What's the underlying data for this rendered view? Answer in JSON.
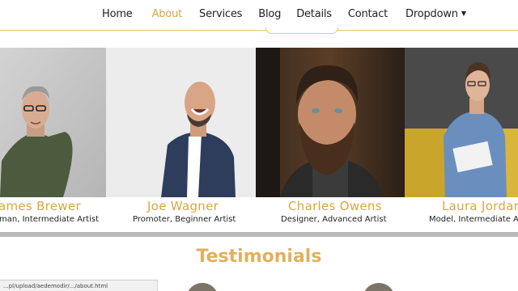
{
  "nav": {
    "items": [
      {
        "label": "Home",
        "active": false
      },
      {
        "label": "About",
        "active": true
      },
      {
        "label": "Services",
        "active": false
      },
      {
        "label": "Blog",
        "active": false
      },
      {
        "label": "Details",
        "active": false
      },
      {
        "label": "Contact",
        "active": false
      },
      {
        "label": "Dropdown",
        "active": false,
        "has_caret": true
      }
    ]
  },
  "team": [
    {
      "name": "ames Brewer",
      "role": "man, Intermediate Artist"
    },
    {
      "name": "Joe Wagner",
      "role": "Promoter, Beginner Artist"
    },
    {
      "name": "Charles Owens",
      "role": "Designer, Advanced Artist"
    },
    {
      "name": "Laura Jordan",
      "role": "Model, Intermediate Ar"
    }
  ],
  "testimonials": {
    "title": "Testimonials"
  },
  "status_bar": {
    "url": "...pl/upload/aedemodir/.../about.html"
  },
  "colors": {
    "accent": "#d9a645",
    "title": "#e2b05c",
    "text": "#222222"
  }
}
